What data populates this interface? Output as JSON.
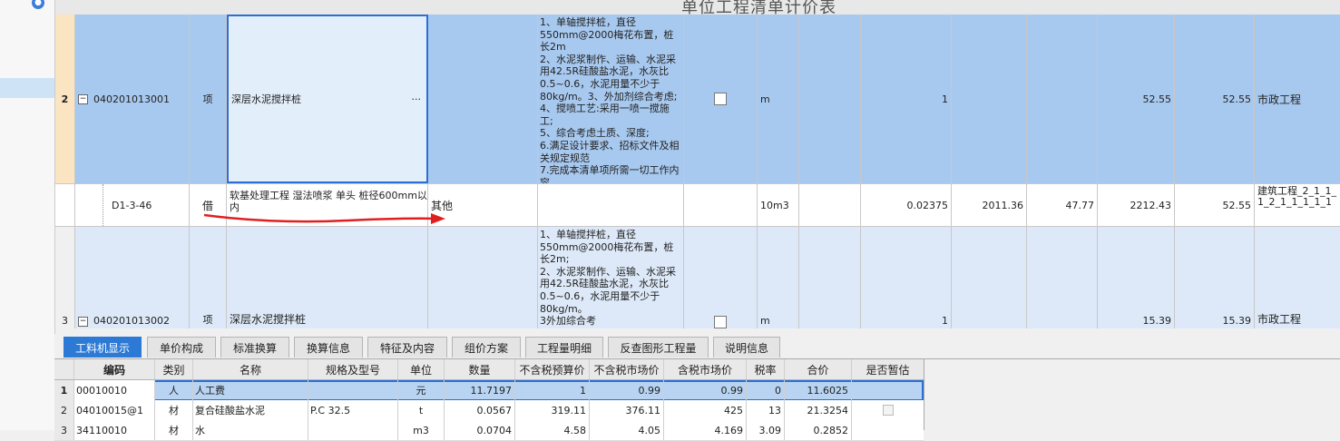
{
  "header": {
    "faded_title": "单位工程清单计价表"
  },
  "rows": [
    {
      "num": "2",
      "code": "040201013001",
      "type": "项",
      "name": "深层水泥搅拌桩",
      "name_more": "···",
      "desc": "1、单轴搅拌桩，直径550mm@2000梅花布置，桩长2m\n2、水泥浆制作、运输、水泥采用42.5R硅酸盐水泥，水灰比0.5~0.6，水泥用量不少于80kg/m。3、外加剂综合考虑;\n4、搅喷工艺:采用一喷一搅施工;\n5、综合考虑土质、深度;\n6.满足设计要求、招标文件及相关规定规范\n7.完成本清单项所需一切工作内容",
      "unit": "m",
      "qty": "1",
      "unit_price": "52.55",
      "total": "52.55",
      "category": "市政工程"
    },
    {
      "num": "",
      "code": "D1-3-46",
      "type": "借",
      "name": "软基处理工程 湿法喷浆 单头 桩径600mm以内",
      "spec": "其他",
      "unit": "10m3",
      "qty": "0.02375",
      "price_a": "2011.36",
      "price_b": "47.77",
      "price_c": "2212.43",
      "total": "52.55",
      "category": "建筑工程_2_1_1_1_2_1_1_1_1_1"
    },
    {
      "num": "3",
      "code": "040201013002",
      "type": "项",
      "name": "深层水泥搅拌桩",
      "desc": "1、单轴搅拌桩，直径550mm@2000梅花布置，桩长2m;\n2、水泥浆制作、运输、水泥采用42.5R硅酸盐水泥，水灰比0.5~0.6，水泥用量不少于80kg/m。\n3外加综合考",
      "unit": "m",
      "qty": "1",
      "unit_price": "15.39",
      "total": "15.39",
      "category": "市政工程"
    }
  ],
  "tabs": [
    "工料机显示",
    "单价构成",
    "标准换算",
    "换算信息",
    "特征及内容",
    "组价方案",
    "工程量明细",
    "反查图形工程量",
    "说明信息"
  ],
  "subgrid": {
    "headers": [
      "编码",
      "类别",
      "名称",
      "规格及型号",
      "单位",
      "数量",
      "不含税预算价",
      "不含税市场价",
      "含税市场价",
      "税率",
      "合价",
      "是否暂估"
    ],
    "rows": [
      {
        "num": "1",
        "code": "00010010",
        "cat": "人",
        "name": "人工费",
        "spec": "",
        "unit": "元",
        "qty": "11.7197",
        "p1": "1",
        "p2": "0.99",
        "p3": "0.99",
        "tax": "0",
        "total": "11.6025"
      },
      {
        "num": "2",
        "code": "04010015@1",
        "cat": "材",
        "name": "复合硅酸盐水泥",
        "spec": "P.C 32.5",
        "unit": "t",
        "qty": "0.0567",
        "p1": "319.11",
        "p2": "376.11",
        "p3": "425",
        "tax": "13",
        "total": "21.3254"
      },
      {
        "num": "3",
        "code": "34110010",
        "cat": "材",
        "name": "水",
        "spec": "",
        "unit": "m3",
        "qty": "0.0704",
        "p1": "4.58",
        "p2": "4.05",
        "p3": "4.169",
        "tax": "3.09",
        "total": "0.2852"
      }
    ]
  }
}
